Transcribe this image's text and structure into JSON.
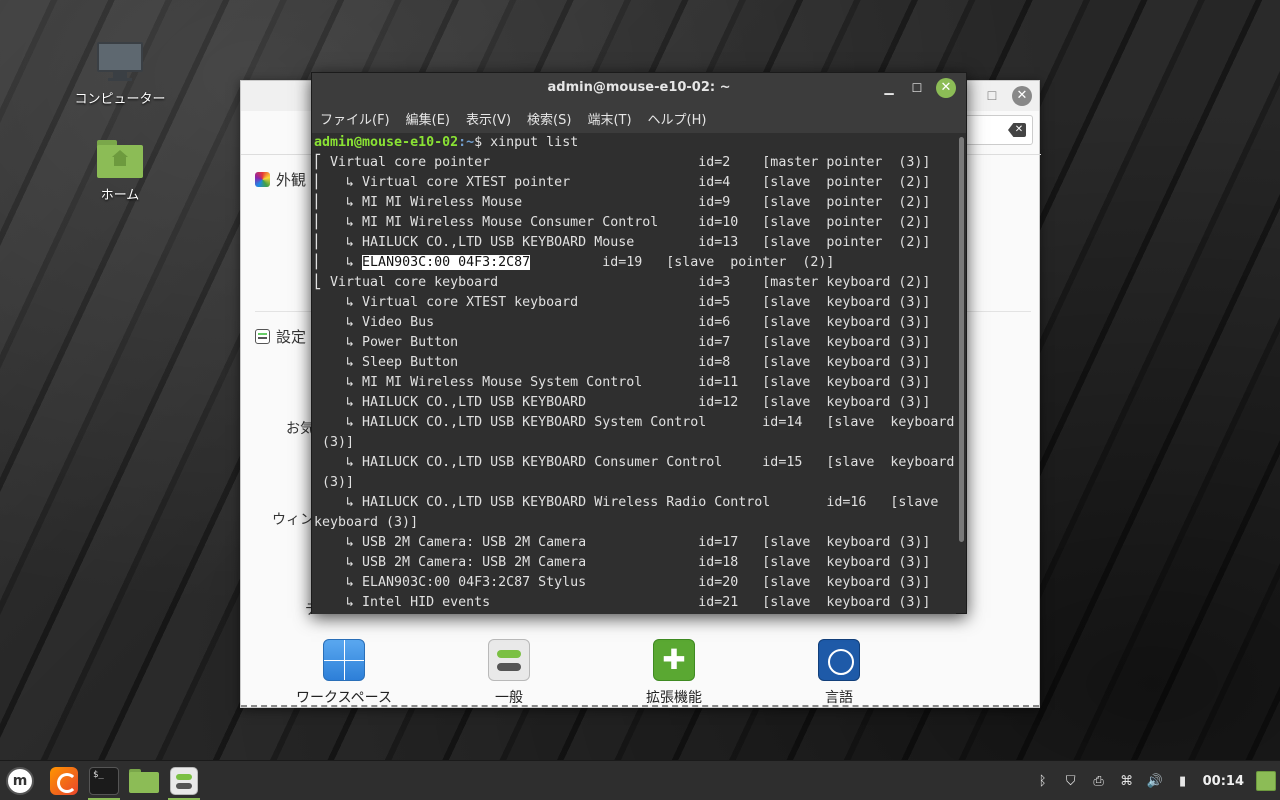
{
  "desktop": {
    "icons": [
      {
        "label": "コンピューター",
        "icon": "computer-icon"
      },
      {
        "label": "ホーム",
        "icon": "home-folder-icon"
      }
    ]
  },
  "settings": {
    "section_appearance": "外観",
    "section_preferences": "設定",
    "side_label_favorites": "お気",
    "side_label_windows": "ウィン",
    "side_label_partial": "デ",
    "tiles": [
      {
        "label": "ワークスペース",
        "icon": "workspace-icon"
      },
      {
        "label": "一般",
        "icon": "general-icon"
      },
      {
        "label": "拡張機能",
        "icon": "extensions-icon"
      },
      {
        "label": "言語",
        "icon": "language-icon"
      }
    ]
  },
  "terminal": {
    "title": "admin@mouse-e10-02: ~",
    "menu": [
      "ファイル(F)",
      "編集(E)",
      "表示(V)",
      "検索(S)",
      "端末(T)",
      "ヘルプ(H)"
    ],
    "prompt_user": "admin@mouse-e10-02",
    "prompt_path": ":~",
    "prompt_symbol": "$ ",
    "command": "xinput list",
    "lines": [
      "⎡ Virtual core pointer                          id=2    [master pointer  (3)]",
      "⎜   ↳ Virtual core XTEST pointer                id=4    [slave  pointer  (2)]",
      "⎜   ↳ MI MI Wireless Mouse                      id=9    [slave  pointer  (2)]",
      "⎜   ↳ MI MI Wireless Mouse Consumer Control     id=10   [slave  pointer  (2)]",
      "⎜   ↳ HAILUCK CO.,LTD USB KEYBOARD Mouse        id=13   [slave  pointer  (2)]",
      "⎜   ↳ ",
      "⎣ Virtual core keyboard                         id=3    [master keyboard (2)]",
      "    ↳ Virtual core XTEST keyboard               id=5    [slave  keyboard (3)]",
      "    ↳ Video Bus                                 id=6    [slave  keyboard (3)]",
      "    ↳ Power Button                              id=7    [slave  keyboard (3)]",
      "    ↳ Sleep Button                              id=8    [slave  keyboard (3)]",
      "    ↳ MI MI Wireless Mouse System Control       id=11   [slave  keyboard (3)]",
      "    ↳ HAILUCK CO.,LTD USB KEYBOARD              id=12   [slave  keyboard (3)]",
      "    ↳ HAILUCK CO.,LTD USB KEYBOARD System Control       id=14   [slave  keyboard",
      " (3)]",
      "    ↳ HAILUCK CO.,LTD USB KEYBOARD Consumer Control     id=15   [slave  keyboard",
      " (3)]",
      "    ↳ HAILUCK CO.,LTD USB KEYBOARD Wireless Radio Control       id=16   [slave",
      "keyboard (3)]",
      "    ↳ USB 2M Camera: USB 2M Camera              id=17   [slave  keyboard (3)]",
      "    ↳ USB 2M Camera: USB 2M Camera              id=18   [slave  keyboard (3)]",
      "    ↳ ELAN903C:00 04F3:2C87 Stylus              id=20   [slave  keyboard (3)]",
      "    ↳ Intel HID events                          id=21   [slave  keyboard (3)]"
    ],
    "highlight_text": "ELAN903C:00 04F3:2C87",
    "highlight_suffix": "         id=19   [slave  pointer  (2)]"
  },
  "taskbar": {
    "items": [
      {
        "name": "mint-menu-icon"
      },
      {
        "name": "firefox-icon"
      },
      {
        "name": "terminal-icon"
      },
      {
        "name": "files-icon"
      },
      {
        "name": "settings-icon"
      }
    ],
    "term_glyph": "$_",
    "mint_glyph": "m",
    "tray": {
      "bluetooth": "ᛒ",
      "shield": "⛉",
      "printer": "⎙",
      "network": "⌘",
      "volume": "🔊",
      "battery": "▮",
      "clock": "00:14"
    }
  }
}
